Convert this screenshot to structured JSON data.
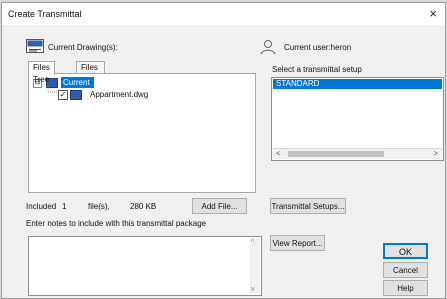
{
  "window": {
    "title": "Create Transmittal",
    "close_label": "×"
  },
  "header": {
    "current_drawings_label": "Current Drawing(s):",
    "current_user_label": "Current user:heron"
  },
  "tabs": [
    {
      "label": "Files Tree",
      "active": true
    },
    {
      "label": "Files Table",
      "active": false
    }
  ],
  "tree": {
    "expander": "⊟",
    "root_label": "Current Drawing",
    "file_checked": "✓",
    "file_label": "Appartment.dwg"
  },
  "summary": {
    "included_label": "Included",
    "count": "1",
    "files_label": "file(s),",
    "size": "280 KB"
  },
  "buttons": {
    "add_file": "Add File...",
    "transmittal_setups": "Transmittal Setups...",
    "view_report": "View Report...",
    "ok": "OK",
    "cancel": "Cancel",
    "help": "Help"
  },
  "setup": {
    "label": "Select a transmittal setup",
    "selected": "STANDARD",
    "left_arrow": "<",
    "right_arrow": ">"
  },
  "notes": {
    "label": "Enter notes to include with this transmittal package",
    "value": "",
    "up_arrow": "^",
    "down_arrow": "v"
  },
  "colors": {
    "selection": "#0078d7",
    "dialog_bg": "#f0f0f0"
  }
}
